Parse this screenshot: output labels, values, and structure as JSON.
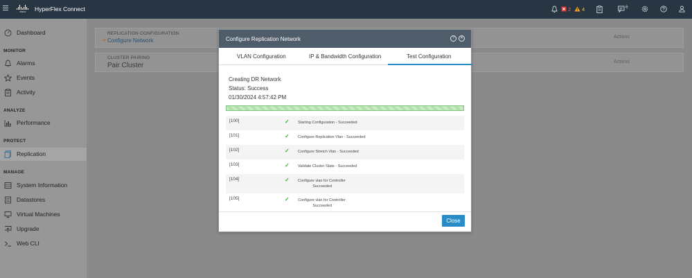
{
  "topbar": {
    "logo_word": "cisco",
    "app_title": "HyperFlex Connect",
    "critical_count": "2",
    "warning_count": "4",
    "message_count": "6",
    "icons": [
      "bell-icon",
      "critical-alert-icon",
      "warning-icon",
      "clipboard-icon",
      "messages-icon",
      "settings-icon",
      "help-icon",
      "user-icon"
    ]
  },
  "nav": {
    "dashboard": "Dashboard",
    "monitor_heading": "MONITOR",
    "alarms": "Alarms",
    "events": "Events",
    "activity": "Activity",
    "analyze_heading": "ANALYZE",
    "performance": "Performance",
    "protect_heading": "PROTECT",
    "replication": "Replication",
    "manage_heading": "MANAGE",
    "system_information": "System Information",
    "datastores": "Datastores",
    "virtual_machines": "Virtual Machines",
    "upgrade": "Upgrade",
    "web_cli": "Web CLI"
  },
  "main": {
    "replication_card": {
      "heading": "REPLICATION CONFIGURATION",
      "link": "Configure Network",
      "actions": "Actions"
    },
    "pairing_card": {
      "heading": "CLUSTER PAIRING",
      "title": "Pair Cluster",
      "actions": "Actions"
    }
  },
  "modal": {
    "title": "Configure Replication Network",
    "tabs": [
      "VLAN Configuration",
      "IP & Bandwidth Configuration",
      "Test Configuration"
    ],
    "active_tab": "Test Configuration",
    "status_title": "Creating DR Network",
    "status": "Status: Success",
    "timestamp": "01/30/2024 4:57:42 PM",
    "progress": 1.0,
    "steps": [
      {
        "code": "[100]",
        "message": "Starting Configuration - Succeeded"
      },
      {
        "code": "[101]",
        "message": "Configure Replication Vlan - Succeeded"
      },
      {
        "code": "[102]",
        "message": "Configure Stretch Vlan - Succeeded"
      },
      {
        "code": "[103]",
        "message": "Validate Cluster State - Succeeded"
      },
      {
        "code": "[104]",
        "message": "Configure vlan for Controller\n              Succeeded"
      },
      {
        "code": "[105]",
        "message": "Configure vlan for Controller\n              Succeeded"
      }
    ],
    "close_label": "Close"
  },
  "colors": {
    "topbar": "#283542",
    "modal_header": "#4f5c69",
    "accent": "#2a8cc7",
    "success": "#3bab3b"
  }
}
